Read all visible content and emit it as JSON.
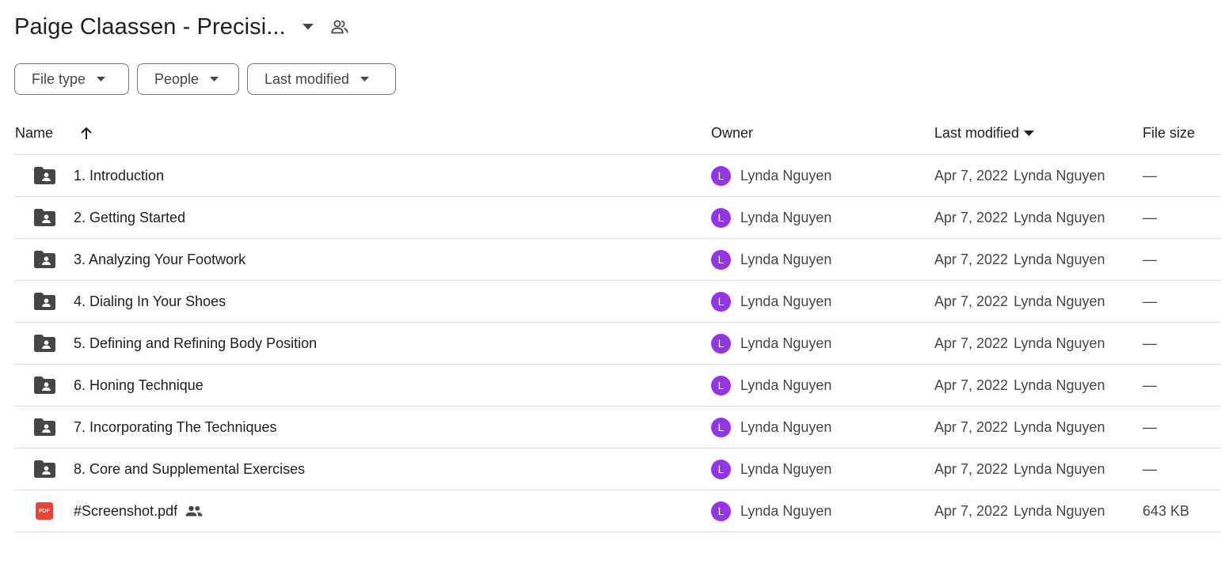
{
  "header": {
    "title": "Paige Claassen - Precisi...",
    "title_menu_icon": "caret-down-icon",
    "share_icon": "people-outline-icon"
  },
  "filters": [
    {
      "label": "File type"
    },
    {
      "label": "People"
    },
    {
      "label": "Last modified"
    }
  ],
  "columns": {
    "name": "Name",
    "owner": "Owner",
    "last_modified": "Last modified",
    "file_size": "File size",
    "sort_icon": "arrow-up-icon"
  },
  "colors": {
    "avatar": "#9334e6",
    "pdf": "#ea4335",
    "folder": "#444746"
  },
  "rows": [
    {
      "icon": "shared-folder-icon",
      "name": "1. Introduction",
      "owner_initial": "L",
      "owner": "Lynda Nguyen",
      "modified_date": "Apr 7, 2022",
      "modified_by": "Lynda Nguyen",
      "size": "—"
    },
    {
      "icon": "shared-folder-icon",
      "name": "2. Getting Started",
      "owner_initial": "L",
      "owner": "Lynda Nguyen",
      "modified_date": "Apr 7, 2022",
      "modified_by": "Lynda Nguyen",
      "size": "—"
    },
    {
      "icon": "shared-folder-icon",
      "name": "3. Analyzing Your Footwork",
      "owner_initial": "L",
      "owner": "Lynda Nguyen",
      "modified_date": "Apr 7, 2022",
      "modified_by": "Lynda Nguyen",
      "size": "—"
    },
    {
      "icon": "shared-folder-icon",
      "name": "4. Dialing In Your Shoes",
      "owner_initial": "L",
      "owner": "Lynda Nguyen",
      "modified_date": "Apr 7, 2022",
      "modified_by": "Lynda Nguyen",
      "size": "—"
    },
    {
      "icon": "shared-folder-icon",
      "name": "5. Defining and Refining Body Position",
      "owner_initial": "L",
      "owner": "Lynda Nguyen",
      "modified_date": "Apr 7, 2022",
      "modified_by": "Lynda Nguyen",
      "size": "—"
    },
    {
      "icon": "shared-folder-icon",
      "name": "6. Honing Technique",
      "owner_initial": "L",
      "owner": "Lynda Nguyen",
      "modified_date": "Apr 7, 2022",
      "modified_by": "Lynda Nguyen",
      "size": "—"
    },
    {
      "icon": "shared-folder-icon",
      "name": "7. Incorporating The Techniques",
      "owner_initial": "L",
      "owner": "Lynda Nguyen",
      "modified_date": "Apr 7, 2022",
      "modified_by": "Lynda Nguyen",
      "size": "—"
    },
    {
      "icon": "shared-folder-icon",
      "name": "8. Core and Supplemental Exercises",
      "owner_initial": "L",
      "owner": "Lynda Nguyen",
      "modified_date": "Apr 7, 2022",
      "modified_by": "Lynda Nguyen",
      "size": "—"
    },
    {
      "icon": "pdf-icon",
      "icon_text": "PDF",
      "name": "#Screenshot.pdf",
      "shared_icon": "people-icon",
      "owner_initial": "L",
      "owner": "Lynda Nguyen",
      "modified_date": "Apr 7, 2022",
      "modified_by": "Lynda Nguyen",
      "size": "643 KB"
    }
  ]
}
